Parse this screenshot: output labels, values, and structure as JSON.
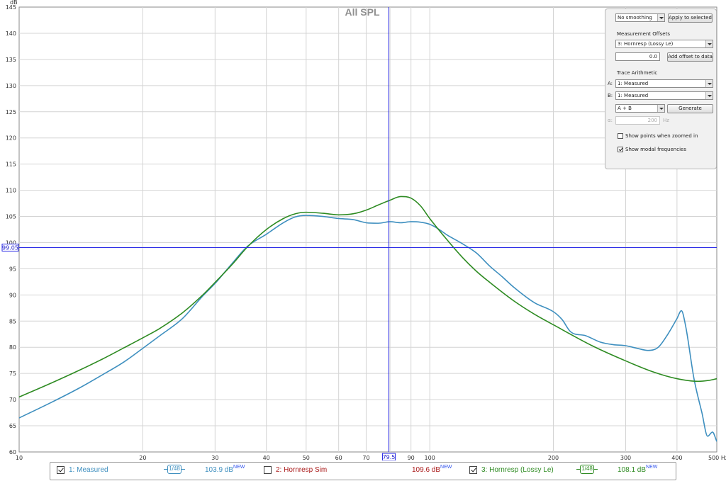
{
  "chart_data": {
    "type": "line",
    "title": "All SPL",
    "ylabel": "dB",
    "xlabel": "Hz",
    "x_scale": "log",
    "xlim": [
      10,
      500
    ],
    "ylim": [
      60,
      145
    ],
    "y_ticks": [
      60,
      65,
      70,
      75,
      80,
      85,
      90,
      95,
      100,
      105,
      110,
      115,
      120,
      125,
      130,
      135,
      140,
      145
    ],
    "x_ticks": [
      10,
      20,
      30,
      40,
      50,
      60,
      70,
      90,
      100,
      200,
      300,
      400,
      500
    ],
    "x_tick_labels": [
      "10",
      "20",
      "30",
      "40",
      "50",
      "60",
      "70",
      "90",
      "100",
      "200",
      "300",
      "400",
      "500 Hz"
    ],
    "grid": true,
    "cursor": {
      "x": 79.5,
      "y": 99.05,
      "x_label": "79.5",
      "y_label": "99.05"
    },
    "series": [
      {
        "name": "1: Measured",
        "color": "#3e8fbf",
        "points": [
          [
            10,
            66.5
          ],
          [
            12,
            69.5
          ],
          [
            14,
            72.2
          ],
          [
            16,
            74.8
          ],
          [
            18,
            77.2
          ],
          [
            20,
            79.8
          ],
          [
            22,
            82.2
          ],
          [
            25,
            85.5
          ],
          [
            28,
            89.8
          ],
          [
            30,
            92.2
          ],
          [
            33,
            96
          ],
          [
            36,
            99.3
          ],
          [
            40,
            101.6
          ],
          [
            44,
            103.8
          ],
          [
            47,
            104.9
          ],
          [
            50,
            105.2
          ],
          [
            55,
            105
          ],
          [
            60,
            104.6
          ],
          [
            65,
            104.4
          ],
          [
            70,
            103.8
          ],
          [
            75,
            103.7
          ],
          [
            80,
            104
          ],
          [
            85,
            103.8
          ],
          [
            90,
            104
          ],
          [
            95,
            103.9
          ],
          [
            100,
            103.5
          ],
          [
            105,
            102.6
          ],
          [
            110,
            101.5
          ],
          [
            120,
            99.8
          ],
          [
            130,
            98
          ],
          [
            140,
            95.5
          ],
          [
            150,
            93.5
          ],
          [
            160,
            91.5
          ],
          [
            180,
            88.5
          ],
          [
            200,
            86.8
          ],
          [
            210,
            85.3
          ],
          [
            220,
            83
          ],
          [
            240,
            82.2
          ],
          [
            260,
            81
          ],
          [
            280,
            80.5
          ],
          [
            300,
            80.3
          ],
          [
            320,
            79.8
          ],
          [
            340,
            79.4
          ],
          [
            360,
            80
          ],
          [
            380,
            82.5
          ],
          [
            400,
            85.5
          ],
          [
            410,
            87
          ],
          [
            420,
            84
          ],
          [
            440,
            74
          ],
          [
            460,
            67.5
          ],
          [
            475,
            63
          ],
          [
            488,
            63.8
          ],
          [
            500,
            62
          ]
        ]
      },
      {
        "name": "3: Hornresp (Lossy Le)",
        "color": "#2e8b22",
        "points": [
          [
            10,
            70.5
          ],
          [
            12,
            73.2
          ],
          [
            14,
            75.6
          ],
          [
            16,
            77.8
          ],
          [
            18,
            79.9
          ],
          [
            20,
            81.8
          ],
          [
            22,
            83.6
          ],
          [
            25,
            86.6
          ],
          [
            28,
            90
          ],
          [
            30,
            92.4
          ],
          [
            33,
            95.8
          ],
          [
            36,
            99.2
          ],
          [
            40,
            102.5
          ],
          [
            44,
            104.6
          ],
          [
            47,
            105.5
          ],
          [
            50,
            105.8
          ],
          [
            55,
            105.6
          ],
          [
            60,
            105.3
          ],
          [
            65,
            105.5
          ],
          [
            70,
            106.2
          ],
          [
            75,
            107.2
          ],
          [
            80,
            108.1
          ],
          [
            85,
            108.8
          ],
          [
            90,
            108.5
          ],
          [
            95,
            107
          ],
          [
            100,
            104.6
          ],
          [
            110,
            100.6
          ],
          [
            120,
            97.2
          ],
          [
            130,
            94.5
          ],
          [
            140,
            92.4
          ],
          [
            160,
            88.9
          ],
          [
            180,
            86.3
          ],
          [
            200,
            84.3
          ],
          [
            250,
            80.2
          ],
          [
            300,
            77.4
          ],
          [
            350,
            75.3
          ],
          [
            400,
            74
          ],
          [
            450,
            73.5
          ],
          [
            480,
            73.7
          ],
          [
            500,
            74
          ]
        ]
      }
    ]
  },
  "panel": {
    "smoothing": "No smoothing",
    "apply_label": "Apply to selected",
    "offsets_heading": "Measurement Offsets",
    "offset_measurement": "3: Hornresp (Lossy Le)",
    "offset_value": "0.0",
    "add_offset_label": "Add offset to data",
    "arith_heading": "Trace Arithmetic",
    "a_label": "A:",
    "a_value": "1: Measured",
    "b_label": "B:",
    "b_value": "1: Measured",
    "operation": "A + B",
    "generate_label": "Generate",
    "alpha_label": "α:",
    "alpha_value": "200",
    "hz_label": "Hz",
    "show_points_label": "Show points when zoomed in",
    "show_points_checked": false,
    "show_modal_label": "Show modal frequencies",
    "show_modal_checked": true
  },
  "legend": [
    {
      "label": "1: Measured",
      "checked": true,
      "smoothing": "1/48",
      "value": "103.9 dB",
      "badge": "NEW",
      "color": "#3e8fbf"
    },
    {
      "label": "2: Hornresp Sim",
      "checked": false,
      "smoothing": "",
      "value": "109.6 dB",
      "badge": "NEW",
      "color": "#aa1a1a"
    },
    {
      "label": "3: Hornresp (Lossy Le)",
      "checked": true,
      "smoothing": "1/48",
      "value": "108.1 dB",
      "badge": "NEW",
      "color": "#2e8b22"
    }
  ]
}
